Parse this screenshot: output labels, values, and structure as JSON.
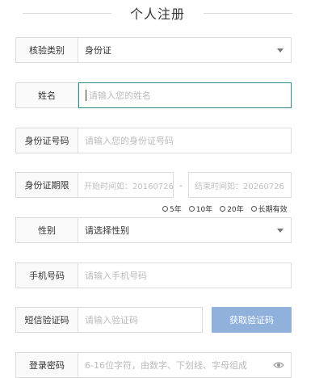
{
  "header": {
    "title": "个人注册"
  },
  "form": {
    "verify_type": {
      "label": "核验类别",
      "value": "身份证"
    },
    "name": {
      "label": "姓名",
      "placeholder": "请输入您的姓名"
    },
    "id_number": {
      "label": "身份证号码",
      "placeholder": "请输入您的身份证号码"
    },
    "id_validity": {
      "label": "身份证期限",
      "start_placeholder": "开始时间如：20160726",
      "separator": "-",
      "end_placeholder": "结束时间如：20260726",
      "options": [
        "5年",
        "10年",
        "20年",
        "长期有效"
      ]
    },
    "gender": {
      "label": "性别",
      "value": "请选择性别"
    },
    "phone": {
      "label": "手机号码",
      "placeholder": "请输入手机号码"
    },
    "sms_code": {
      "label": "短信验证码",
      "placeholder": "请输入验证码",
      "button": "获取验证码"
    },
    "password": {
      "label": "登录密码",
      "placeholder": "6-16位字符，由数字、下划线、字母组成"
    }
  },
  "colors": {
    "accent_button": "#8fb1dc",
    "focus_border": "#2e8b8b"
  }
}
